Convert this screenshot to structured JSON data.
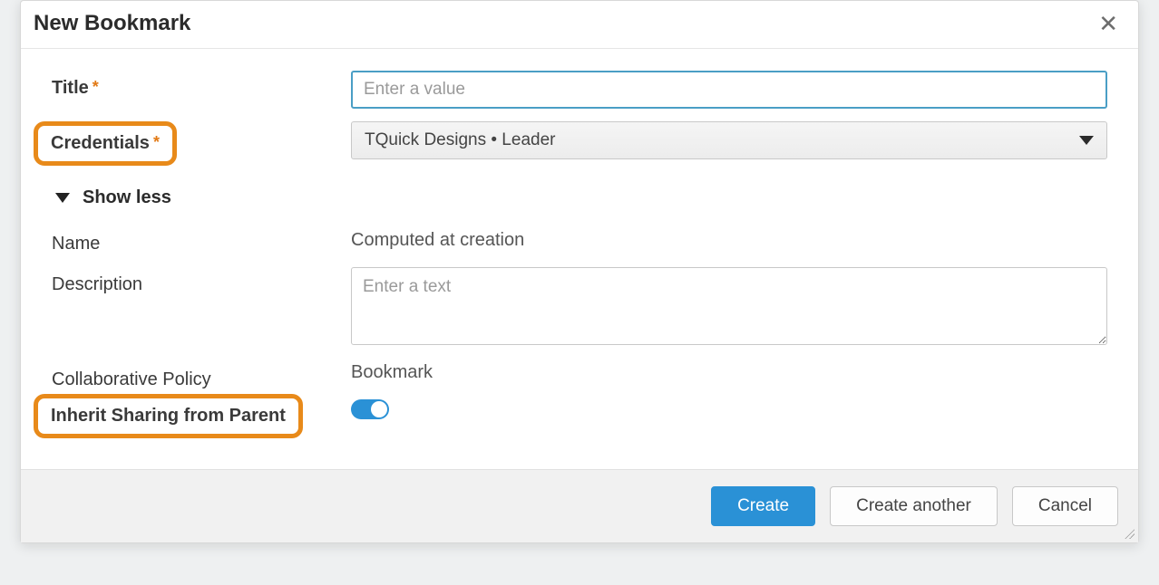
{
  "dialog": {
    "title": "New Bookmark",
    "close_aria": "Close"
  },
  "fields": {
    "title": {
      "label": "Title",
      "placeholder": "Enter a value",
      "required": true,
      "value": ""
    },
    "credentials": {
      "label": "Credentials",
      "required": true,
      "selected": "TQuick Designs • Leader"
    },
    "show_less": "Show less",
    "name": {
      "label": "Name",
      "value": "Computed at creation"
    },
    "description": {
      "label": "Description",
      "placeholder": "Enter a text",
      "value": ""
    },
    "collab_policy": {
      "label": "Collaborative Policy",
      "value": "Bookmark"
    },
    "inherit": {
      "label": "Inherit Sharing from Parent",
      "on": true
    }
  },
  "buttons": {
    "create": "Create",
    "create_another": "Create another",
    "cancel": "Cancel"
  }
}
